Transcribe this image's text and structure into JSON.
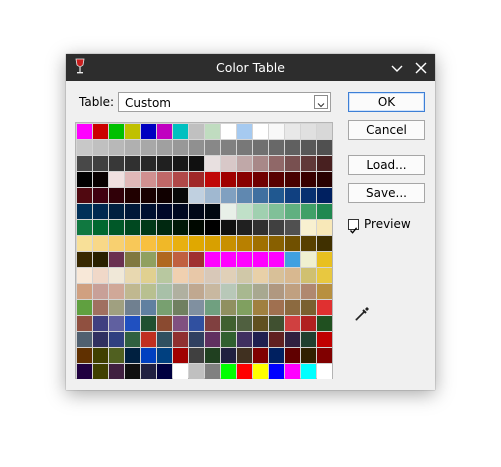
{
  "window": {
    "title": "Color Table"
  },
  "table": {
    "label": "Table:",
    "value": "Custom"
  },
  "buttons": {
    "ok": "OK",
    "cancel": "Cancel",
    "load": "Load...",
    "save": "Save..."
  },
  "preview": {
    "label": "Preview",
    "checked": true
  },
  "colors": [
    "#ff00ff",
    "#cc0000",
    "#00c000",
    "#c0c000",
    "#0000c0",
    "#c000c0",
    "#00c0c0",
    "#c0c0c0",
    "#c0dcc0",
    "#ffffff",
    "#a6caf0",
    "#ffffff",
    "#f8f8f8",
    "#e8e8e8",
    "#e0e0e0",
    "#d8d8d8",
    "#c8c8c8",
    "#c0c0c0",
    "#b8b8b8",
    "#b0b0b0",
    "#a8a8a8",
    "#a0a0a0",
    "#989898",
    "#909090",
    "#888888",
    "#808080",
    "#787878",
    "#707070",
    "#686868",
    "#606060",
    "#585858",
    "#505050",
    "#484848",
    "#404040",
    "#383838",
    "#303030",
    "#282828",
    "#202020",
    "#181818",
    "#101010",
    "#e8e0e0",
    "#d8c8c8",
    "#c0a8a8",
    "#a88888",
    "#906868",
    "#785050",
    "#603838",
    "#482020",
    "#000000",
    "#080000",
    "#f0e0e0",
    "#e0b8b8",
    "#d09090",
    "#c06868",
    "#b04848",
    "#a02828",
    "#c00808",
    "#a00000",
    "#880000",
    "#700000",
    "#580000",
    "#480000",
    "#380000",
    "#280000",
    "#500810",
    "#400010",
    "#300008",
    "#200000",
    "#180000",
    "#100000",
    "#080808",
    "#c0d0e0",
    "#a0b8d0",
    "#80a0c0",
    "#6088b0",
    "#4070a0",
    "#205890",
    "#104080",
    "#083070",
    "#002060",
    "#003058",
    "#002850",
    "#002040",
    "#001838",
    "#001030",
    "#000828",
    "#000820",
    "#000818",
    "#000810",
    "#e8f0e8",
    "#c0e0c8",
    "#a0d0b0",
    "#80c098",
    "#60b080",
    "#40a068",
    "#208850",
    "#107840",
    "#006830",
    "#005828",
    "#004820",
    "#003818",
    "#002810",
    "#001808",
    "#000800",
    "#000000",
    "#101010",
    "#202020",
    "#303030",
    "#404040",
    "#505050",
    "#f8f0d0",
    "#f8e8b8",
    "#f8e098",
    "#f8d888",
    "#f8d070",
    "#f8c858",
    "#f8c040",
    "#f0b828",
    "#e8b010",
    "#e0a800",
    "#d8a000",
    "#c89000",
    "#b88000",
    "#a07000",
    "#886000",
    "#705000",
    "#584000",
    "#403000",
    "#382800",
    "#282000",
    "#6a3050",
    "#807840",
    "#90a060",
    "#b06820",
    "#c06040",
    "#a03030",
    "#ff00ff",
    "#ff00ff",
    "#ff00ff",
    "#ff00ff",
    "#ff00ff",
    "#40a0e0",
    "#f0f0d0",
    "#e8c020",
    "#f8e8d8",
    "#f0d8c8",
    "#f0e8d8",
    "#e8d8b0",
    "#e0d090",
    "#b8c8a0",
    "#f0d0b0",
    "#e8c8a8",
    "#d8c8b8",
    "#e0d0b8",
    "#d0c8a8",
    "#e8d0a8",
    "#d8c098",
    "#d8b890",
    "#d0c070",
    "#e8c840",
    "#d0a080",
    "#c8a098",
    "#d0a898",
    "#c0b890",
    "#b8c090",
    "#a8c0a8",
    "#b0b0a0",
    "#c0a890",
    "#c8b8a0",
    "#b8c8b8",
    "#a8b890",
    "#a8a890",
    "#b09880",
    "#c0a080",
    "#b08870",
    "#b89040",
    "#60a040",
    "#a07060",
    "#a0a080",
    "#708090",
    "#6080a0",
    "#78a070",
    "#708060",
    "#8090a0",
    "#70a080",
    "#909060",
    "#80a060",
    "#a08040",
    "#a07050",
    "#8c6a40",
    "#7a6030",
    "#e03030",
    "#905040",
    "#404080",
    "#6060a0",
    "#2050c0",
    "#205030",
    "#8a4a30",
    "#805080",
    "#3050a0",
    "#804040",
    "#406030",
    "#506040",
    "#605020",
    "#405030",
    "#d04040",
    "#b02020",
    "#205020",
    "#506070",
    "#303060",
    "#304080",
    "#306040",
    "#c03020",
    "#305060",
    "#903030",
    "#304060",
    "#603060",
    "#306030",
    "#403060",
    "#202050",
    "#602020",
    "#302040",
    "#204030",
    "#c00000",
    "#603000",
    "#404000",
    "#506020",
    "#002040",
    "#0040c0",
    "#004080",
    "#a00000",
    "#404040",
    "#204020",
    "#202040",
    "#403020",
    "#800000",
    "#002060",
    "#600000",
    "#302000",
    "#800000",
    "#200040",
    "#404000",
    "#402040",
    "#101010",
    "#202040",
    "#000040",
    "#ffffff",
    "#c0c0c0",
    "#808080",
    "#00ff00",
    "#ff0000",
    "#ffff00",
    "#0000ff",
    "#ff00ff",
    "#00ffff",
    "#ffffff"
  ]
}
